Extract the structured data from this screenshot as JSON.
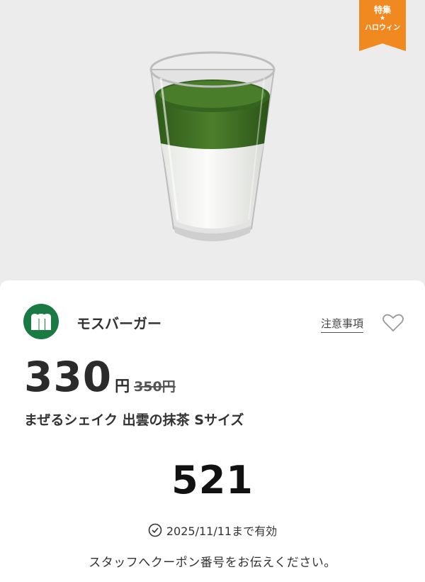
{
  "badge": {
    "top": "特集",
    "star": "★",
    "bottom": "ハロウィン"
  },
  "brand": {
    "name": "モスバーガー",
    "logo_icon": "mos-burger-logo-icon",
    "color": "#1a7a44"
  },
  "header_actions": {
    "notes_label": "注意事項",
    "favorite_icon": "heart-outline-icon"
  },
  "price": {
    "current": "330",
    "unit": "円",
    "original": "350円"
  },
  "product": {
    "name": "まぜるシェイク 出雲の抹茶 Sサイズ",
    "image": "matcha-shake-glass"
  },
  "coupon": {
    "code": "521"
  },
  "validity": {
    "icon": "clock-check-icon",
    "text": "2025/11/11まで有効"
  },
  "instruction": "スタッフへクーポン番号をお伝えください。",
  "colors": {
    "badge": "#f0891f",
    "brand_green": "#1a7a44",
    "matcha": "#3f6f24"
  }
}
